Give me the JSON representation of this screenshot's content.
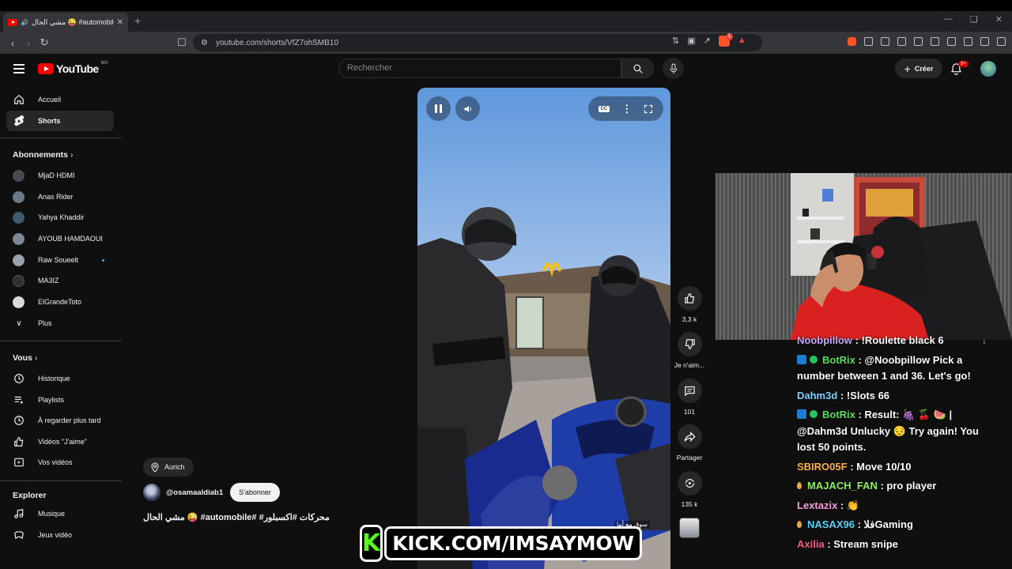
{
  "browser": {
    "tab_title": "مشي الحال 😜 #automobile‏ (255)",
    "url": "youtube.com/shorts/VfZ7ohSMB10",
    "brave_badge": "1"
  },
  "header": {
    "logo_text": "YouTube",
    "country_code": "MA",
    "search_placeholder": "Rechercher",
    "create_label": "Créer",
    "notif_count": "9+"
  },
  "sidebar": {
    "main": [
      {
        "label": "Accueil",
        "icon": "home-icon"
      },
      {
        "label": "Shorts",
        "icon": "shorts-icon",
        "active": true
      }
    ],
    "subs_heading": "Abonnements",
    "subscriptions": [
      {
        "label": "MjaD HDMI",
        "color": "#4a4a52"
      },
      {
        "label": "Anas Rider",
        "color": "#6b7a88"
      },
      {
        "label": "Yahya Khaddir",
        "color": "#3d5a6e"
      },
      {
        "label": "AYOUB HAMDAOUI",
        "color": "#7e8795"
      },
      {
        "label": "Raw Soueelt",
        "color": "#9aa1aa"
      },
      {
        "label": "MA3IZ",
        "color": "#2f2f33"
      },
      {
        "label": "ElGrandeToto",
        "color": "#d9d9d9"
      }
    ],
    "more_label": "Plus",
    "you_heading": "Vous",
    "you_items": [
      {
        "label": "Historique",
        "icon": "history-icon"
      },
      {
        "label": "Playlists",
        "icon": "playlists-icon"
      },
      {
        "label": "À regarder plus tard",
        "icon": "watch-later-icon"
      },
      {
        "label": "Vidéos \"J'aime\"",
        "icon": "liked-icon"
      },
      {
        "label": "Vos vidéos",
        "icon": "your-videos-icon"
      }
    ],
    "explore_heading": "Explorer",
    "explore_items": [
      {
        "label": "Musique",
        "icon": "music-icon"
      },
      {
        "label": "Jeux vidéo",
        "icon": "gaming-icon"
      }
    ]
  },
  "short": {
    "location": "Aurich",
    "channel_handle": "@osamaaldiab1",
    "subscribe_label": "S'abonner",
    "title": "مشي الحال 😜 #automobile# #محركات #اكسبلور",
    "video_caption": "سوق مع أما",
    "actions": {
      "likes": "3,3 k",
      "dislike_label": "Je n'aim...",
      "comments": "101",
      "share_label": "Partager",
      "remix": "135 k"
    }
  },
  "chat": [
    {
      "user": "Noobpillow",
      "color": "#c9a7ff",
      "text": ": !Roulette black 6",
      "badges": []
    },
    {
      "user": "BotRix",
      "color": "#58e05a",
      "text": ": @Noobpillow Pick a number between 1 and 36. Let's go!",
      "badges": [
        "bot",
        "verified"
      ]
    },
    {
      "user": "Dahm3d",
      "color": "#7ed2ff",
      "text": ": !Slots 66",
      "badges": []
    },
    {
      "user": "BotRix",
      "color": "#58e05a",
      "text": ": Result: 🍇 🍒 🍉 | @Dahm3d Unlucky 😔 Try again! You lost 50 points.",
      "badges": [
        "bot",
        "verified"
      ]
    },
    {
      "user": "SBIRO05F",
      "color": "#ffb347",
      "text": ": Move 10/10",
      "badges": []
    },
    {
      "user": "MAJACH_FAN",
      "color": "#8ef05a",
      "text": ": pro player",
      "badges": [
        "drop"
      ]
    },
    {
      "user": "Lextazix",
      "color": "#ff9de2",
      "text": ": 👏",
      "badges": []
    },
    {
      "user": "NASAX96",
      "color": "#5ad6ff",
      "text": ": فلاGaming",
      "badges": [
        "drop"
      ]
    },
    {
      "user": "Axilia",
      "color": "#ff5a8a",
      "text": ": Stream snipe",
      "badges": []
    }
  ],
  "overlay": {
    "kick_logo": "K",
    "kick_text": "KICK.COM/IMSAYMOW",
    "kick_green": "#53fc18"
  }
}
